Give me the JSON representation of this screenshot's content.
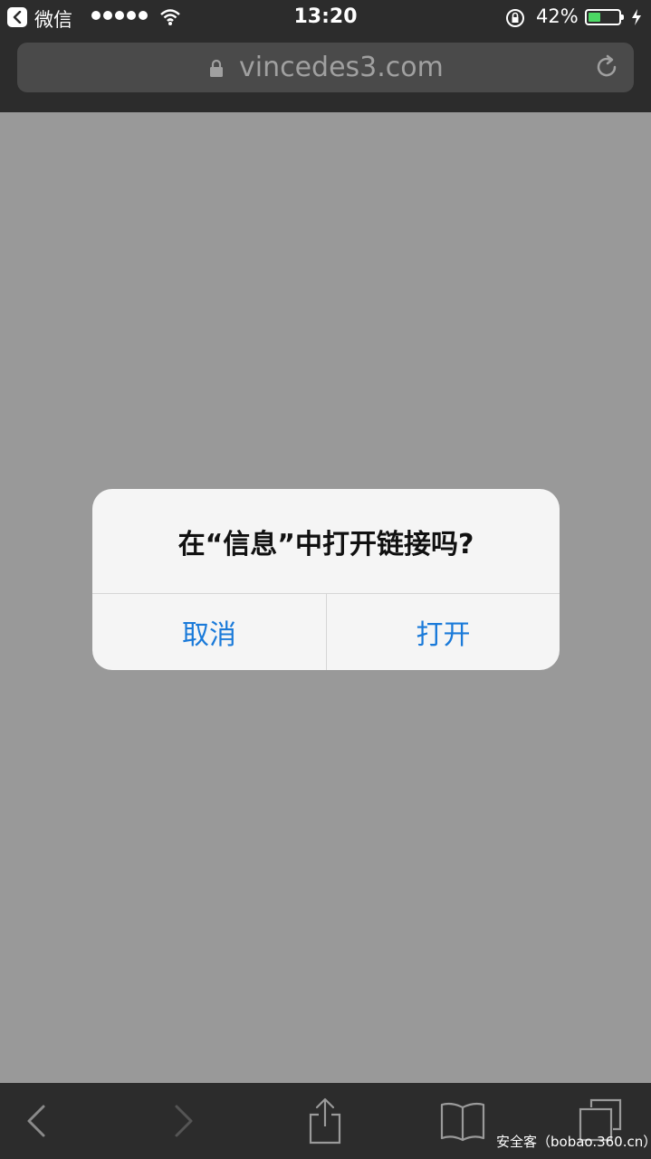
{
  "status_bar": {
    "app_name": "微信",
    "time": "13:20",
    "battery_percent": "42%",
    "battery_level": 0.42,
    "battery_color": "#4cd964"
  },
  "address_bar": {
    "url": "vincedes3.com"
  },
  "alert": {
    "title": "在“信息”中打开链接吗?",
    "cancel_label": "取消",
    "open_label": "打开",
    "button_color": "#1a7ad9"
  },
  "toolbar": {
    "icons": [
      "back-icon",
      "forward-icon",
      "share-icon",
      "bookmarks-icon",
      "tabs-icon"
    ]
  },
  "watermark": "安全客（bobao.360.cn）"
}
